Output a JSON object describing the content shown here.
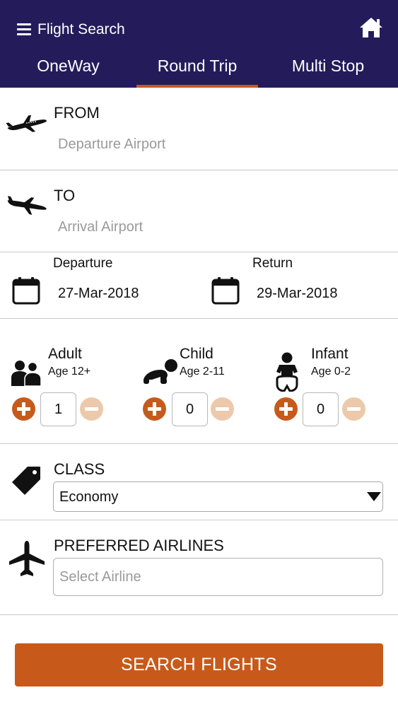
{
  "header": {
    "title": "Flight Search",
    "menu_icon": "hamburger-menu-icon",
    "home_icon": "home-icon",
    "background": "#241c5a"
  },
  "tabs": [
    {
      "label": "OneWay",
      "active": false
    },
    {
      "label": "Round Trip",
      "active": true
    },
    {
      "label": "Multi Stop",
      "active": false
    }
  ],
  "from": {
    "label": "FROM",
    "placeholder": "Departure Airport",
    "icon": "plane-takeoff-icon"
  },
  "to": {
    "label": "TO",
    "placeholder": "Arrival Airport",
    "icon": "plane-landing-icon"
  },
  "dates": {
    "departure_label": "Departure",
    "departure_value": "27-Mar-2018",
    "return_label": "Return",
    "return_value": "29-Mar-2018",
    "icon": "calendar-icon"
  },
  "passengers": [
    {
      "title": "Adult",
      "age": "Age 12+",
      "count": "1",
      "icon": "adult-icon"
    },
    {
      "title": "Child",
      "age": "Age 2-11",
      "count": "0",
      "icon": "child-icon"
    },
    {
      "title": "Infant",
      "age": "Age 0-2",
      "count": "0",
      "icon": "infant-icon"
    }
  ],
  "travel_class": {
    "label": "CLASS",
    "selected": "Economy",
    "icon": "tag-icon"
  },
  "airlines": {
    "label": "PREFERRED AIRLINES",
    "placeholder": "Select Airline",
    "icon": "airplane-icon"
  },
  "search_button": {
    "label": "SEARCH FLIGHTS"
  },
  "colors": {
    "accent": "#c75a1b",
    "accent_light": "#ecc9aa",
    "header_bg": "#241c5a"
  }
}
